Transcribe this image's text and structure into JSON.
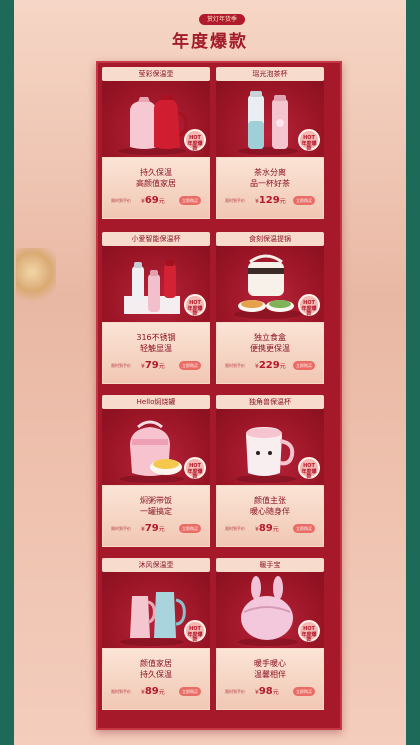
{
  "header": {
    "pill": "赏灯年货季",
    "title": "年度爆款"
  },
  "hot_badge": "HOT",
  "hot_sub": "年度爆款",
  "price_label": "限时到手价",
  "buy_label": "立即购买",
  "currency": "¥",
  "price_suffix": "元",
  "products": [
    {
      "name": "莹彩保温壶",
      "feature1": "持久保温",
      "feature2": "高颜值家居",
      "price": "69"
    },
    {
      "name": "瑶光泡茶杯",
      "feature1": "茶水分离",
      "feature2": "品一杯好茶",
      "price": "129"
    },
    {
      "name": "小爱智能保温杯",
      "feature1": "316不锈钢",
      "feature2": "轻触显温",
      "price": "79"
    },
    {
      "name": "食刻保温提锅",
      "feature1": "独立食盒",
      "feature2": "便携更保温",
      "price": "229"
    },
    {
      "name": "Hello焖烧罐",
      "feature1": "焖粥带饭",
      "feature2": "一罐搞定",
      "price": "79"
    },
    {
      "name": "独角兽保温杯",
      "feature1": "颜值主张",
      "feature2": "暖心随身伴",
      "price": "89"
    },
    {
      "name": "沐风保温壶",
      "feature1": "颜值家居",
      "feature2": "持久保温",
      "price": "89"
    },
    {
      "name": "暖手宝",
      "feature1": "暖手暖心",
      "feature2": "温馨相伴",
      "price": "98"
    }
  ],
  "colors": {
    "brand_red": "#a5192a",
    "outer_green": "#1e6a58",
    "cream": "#f7dccd"
  }
}
